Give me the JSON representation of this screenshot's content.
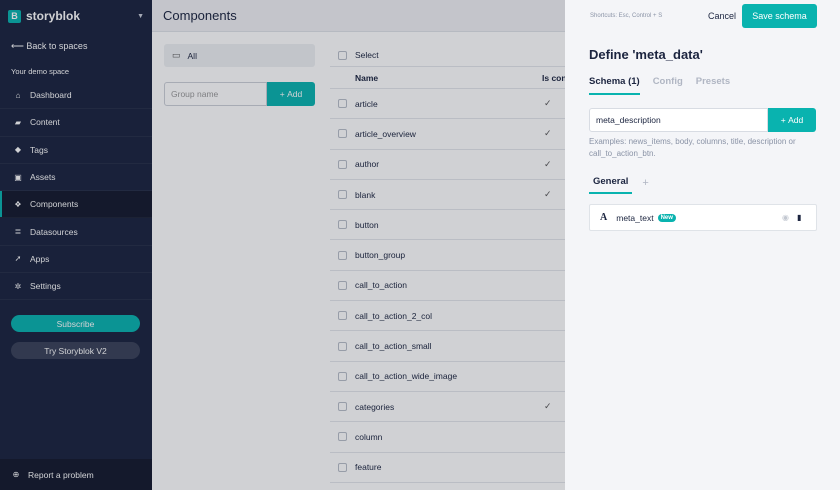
{
  "sidebar": {
    "brand": "storyblok",
    "brand_logo": "B",
    "back_label": "Back to spaces",
    "space_name": "Your demo space",
    "items": [
      {
        "label": "Dashboard",
        "icon": "home-icon"
      },
      {
        "label": "Content",
        "icon": "folder-icon"
      },
      {
        "label": "Tags",
        "icon": "tag-icon"
      },
      {
        "label": "Assets",
        "icon": "image-icon"
      },
      {
        "label": "Components",
        "icon": "components-icon",
        "active": true
      },
      {
        "label": "Datasources",
        "icon": "database-icon"
      },
      {
        "label": "Apps",
        "icon": "rocket-icon"
      },
      {
        "label": "Settings",
        "icon": "gear-icon"
      }
    ],
    "subscribe_label": "Subscribe",
    "try_v2_label": "Try Storyblok V2",
    "report_label": "Report a problem"
  },
  "main": {
    "title": "Components",
    "groups": {
      "all_label": "All",
      "group_placeholder": "Group name",
      "add_label": "Add"
    },
    "table": {
      "select_label": "Select",
      "col_name": "Name",
      "col_is_content": "Is con",
      "rows": [
        {
          "name": "article",
          "check": "✓"
        },
        {
          "name": "article_overview",
          "check": "✓"
        },
        {
          "name": "author",
          "check": "✓"
        },
        {
          "name": "blank",
          "check": "✓"
        },
        {
          "name": "button",
          "check": ""
        },
        {
          "name": "button_group",
          "check": ""
        },
        {
          "name": "call_to_action",
          "check": ""
        },
        {
          "name": "call_to_action_2_col",
          "check": ""
        },
        {
          "name": "call_to_action_small",
          "check": ""
        },
        {
          "name": "call_to_action_wide_image",
          "check": ""
        },
        {
          "name": "categories",
          "check": "✓"
        },
        {
          "name": "column",
          "check": ""
        },
        {
          "name": "feature",
          "check": ""
        }
      ]
    }
  },
  "panel": {
    "shortcuts": "Shortcuts: Esc, Control + S",
    "cancel_label": "Cancel",
    "save_label": "Save schema",
    "title": "Define 'meta_data'",
    "tabs": [
      "Schema (1)",
      "Config",
      "Presets"
    ],
    "field_value": "meta_description",
    "add_label": "Add",
    "examples": "Examples: news_items, body, columns, title, description or call_to_action_btn.",
    "general_tab": "General",
    "field_item": {
      "type_glyph": "A",
      "name": "meta_text",
      "badge": "New"
    }
  },
  "colors": {
    "accent": "#09b3af",
    "sidebar": "#1b243f"
  }
}
